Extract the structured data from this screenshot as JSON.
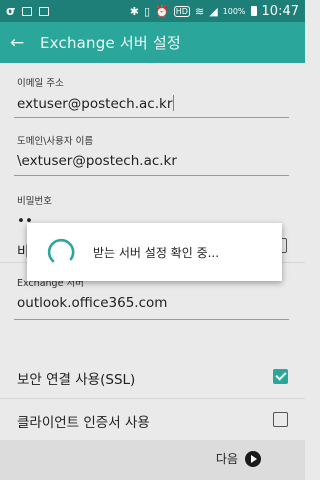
{
  "status_bar": {
    "left_icons": [
      "sigma-icon",
      "gallery-icon",
      "screenshot-icon"
    ],
    "right_icons": [
      "bluetooth-icon",
      "vibrate-icon",
      "alarm-icon",
      "hd-icon",
      "wifi-icon",
      "signal-icon"
    ],
    "battery_percent": "100%",
    "time": "10:47"
  },
  "app_bar": {
    "title": "Exchange 서버 설정"
  },
  "fields": {
    "email": {
      "label": "이메일 주소",
      "value": "extuser@postech.ac.kr"
    },
    "domain_user": {
      "label": "도메인\\사용자 이름",
      "value": "\\extuser@postech.ac.kr"
    },
    "password": {
      "label": "비밀번호",
      "value": "••"
    },
    "hidden_row_label": "비",
    "exchange_server": {
      "label": "Exchange 서버",
      "value": "outlook.office365.com"
    }
  },
  "options": {
    "ssl": {
      "label": "보안 연결 사용(SSL)",
      "checked": true
    },
    "client_cert": {
      "label": "클라이언트 인증서 사용",
      "checked": false
    }
  },
  "bottom_bar": {
    "next_label": "다음"
  },
  "dialog": {
    "message": "받는 서버 설정 확인 중..."
  },
  "colors": {
    "status_bar": "#1d7f78",
    "app_bar": "#2aa69a",
    "accent": "#2aa69a"
  }
}
